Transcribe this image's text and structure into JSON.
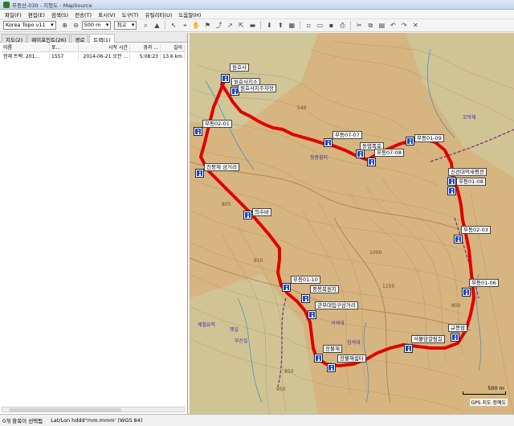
{
  "window": {
    "title": "무등산-030 - 지형도 - MapSource"
  },
  "menu": [
    "파일(F)",
    "편집(E)",
    "검색(S)",
    "전송(T)",
    "표시(V)",
    "도구(T)",
    "유틸리티(U)",
    "도움말(H)"
  ],
  "toolbar": {
    "map_product": "Korea Topo v11",
    "zoom_scale": "500 m",
    "detail": "최고"
  },
  "left_panel": {
    "tabs": [
      "지도(2)",
      "웨이포인트(26)",
      "경로",
      "트랙(1)"
    ],
    "active_tab": "트랙(1)",
    "columns": [
      "이름",
      "포...",
      "시작 시간",
      "경과 ...",
      "길이"
    ],
    "rows": [
      [
        "현재 트랙: 201...",
        "1557",
        "2014-06-21 오전 ...",
        "5:08:23",
        "13.6 km"
      ]
    ]
  },
  "map": {
    "waypoints": [
      {
        "label": "원효사"
      },
      {
        "label": "원효사지소"
      },
      {
        "label": "원효사지주차장"
      },
      {
        "label": "무등02-01"
      },
      {
        "label": "무등07-07"
      },
      {
        "label": "동엽폭포"
      },
      {
        "label": "무등07-08"
      },
      {
        "label": "무등01-09"
      },
      {
        "label": "신선대억새평전"
      },
      {
        "label": "무등01-08"
      },
      {
        "label": "진평재 삼거리"
      },
      {
        "label": "의수바"
      },
      {
        "label": "무등01-10"
      },
      {
        "label": "중봉복원지"
      },
      {
        "label": "군부대입구삼거리"
      },
      {
        "label": "규봉암"
      },
      {
        "label": "석불암갈림길"
      },
      {
        "label": "장불재"
      },
      {
        "label": "장불재쉼터"
      },
      {
        "label": "무등01-06"
      },
      {
        "label": "규봉암"
      },
      {
        "label": "무등02-03"
      }
    ],
    "terrain_labels": [
      "549",
      "805",
      "910",
      "1000",
      "1150",
      "800",
      "850",
      "950"
    ],
    "place_labels": [
      "청풍쉼터",
      "제철유적",
      "옛길",
      "꼬막재",
      "부산길",
      "입석대",
      "서석대"
    ],
    "scale_label": "500 m",
    "credit": "GPS 지도 정예도"
  },
  "status": {
    "selection": "0개 항목이 선택됨",
    "coord_format": "Lat/Lon hddd°mm.mmm' (WGS 84)"
  },
  "colors": {
    "track": "#e00000",
    "terrain": "#d9ba86",
    "waypoint": "#1c48c9"
  }
}
